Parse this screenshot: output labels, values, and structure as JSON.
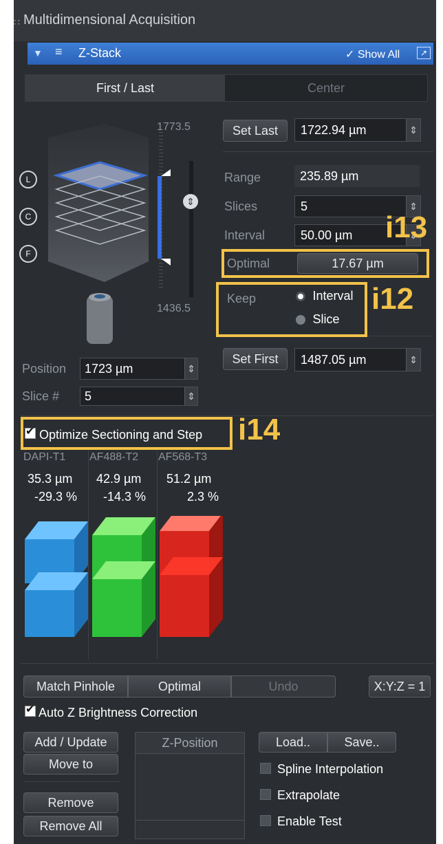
{
  "header": {
    "title": "Multidimensional Acquisition"
  },
  "section": {
    "title": "Z-Stack",
    "show_all": "Show All"
  },
  "tabs": [
    "First / Last",
    "Center"
  ],
  "stack": {
    "top": "1773.5",
    "bottom": "1436.5",
    "markers": [
      "L",
      "C",
      "F"
    ]
  },
  "controls": {
    "set_last": "Set Last",
    "last_value": "1722.94 µm",
    "range_label": "Range",
    "range_value": "235.89 µm",
    "slices_label": "Slices",
    "slices_value": "5",
    "interval_label": "Interval",
    "interval_value": "50.00 µm",
    "optimal_label": "Optimal",
    "optimal_value": "17.67 µm",
    "keep_label": "Keep",
    "keep_interval": "Interval",
    "keep_slice": "Slice",
    "set_first": "Set First",
    "first_value": "1487.05 µm",
    "position_label": "Position",
    "position_value": "1723 µm",
    "slice_label": "Slice #",
    "slice_value": "5"
  },
  "optimize": {
    "label": "Optimize Sectioning and Step",
    "checked": true
  },
  "channels": [
    {
      "name": "DAPI-T1",
      "thickness": "35.3 µm",
      "pct": "-29.3 %",
      "color": "#2a8fd8"
    },
    {
      "name": "AF488-T2",
      "thickness": "42.9 µm",
      "pct": "-14.3 %",
      "color": "#2ec23a"
    },
    {
      "name": "AF568-T3",
      "thickness": "51.2 µm",
      "pct": "2.3 %",
      "color": "#d8261e"
    }
  ],
  "bottom": {
    "match_pinhole": "Match Pinhole",
    "optimal": "Optimal",
    "undo": "Undo",
    "ratio": "X:Y:Z = 1",
    "auto_z": "Auto Z Brightness Correction",
    "add_update": "Add / Update",
    "move_to": "Move to",
    "remove": "Remove",
    "remove_all": "Remove All",
    "z_position": "Z-Position",
    "load": "Load..",
    "save": "Save..",
    "spline": "Spline Interpolation",
    "extrapolate": "Extrapolate",
    "enable_test": "Enable Test"
  },
  "annotations": {
    "i12": "i12",
    "i13": "i13",
    "i14": "i14"
  },
  "colors": {
    "accent": "#3e7fd8",
    "annotation": "#f2c24a"
  }
}
